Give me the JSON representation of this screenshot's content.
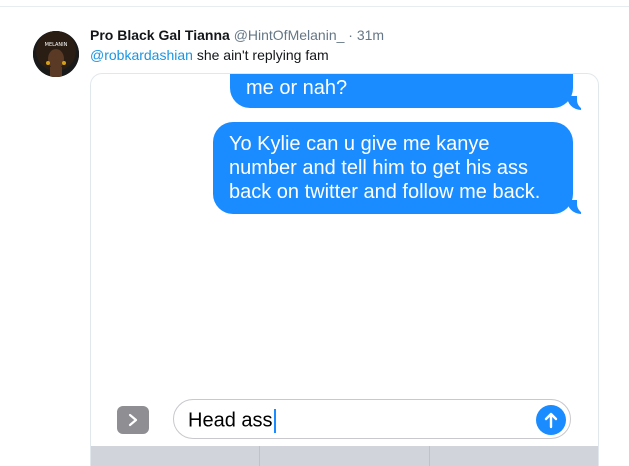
{
  "tweet": {
    "display_name": "Pro Black Gal Tianna",
    "handle": "@HintOfMelanin_",
    "separator": "·",
    "timestamp": "31m",
    "mention": "@robkardashian",
    "text": " she ain't replying fam",
    "avatar_icon": "afro-woman-avatar-icon"
  },
  "imessage": {
    "messages": [
      {
        "text": "me or nah?"
      },
      {
        "text": "Yo Kylie can u give me kanye number and tell him to get his ass back on twitter and follow me back."
      }
    ],
    "input_value": "Head ass",
    "expand_icon": "chevron-right-icon",
    "send_icon": "arrow-up-icon",
    "bubble_color": "#1a8cff"
  },
  "colors": {
    "mention": "#1b95e0",
    "meta": "#657786"
  }
}
